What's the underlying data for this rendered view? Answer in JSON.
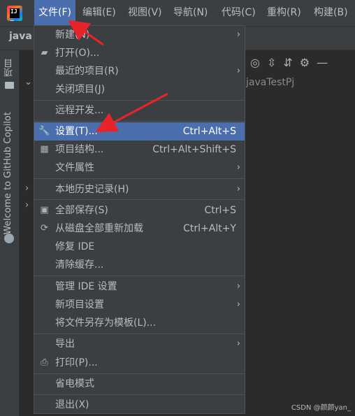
{
  "menubar": {
    "items": [
      "文件(F)",
      "编辑(E)",
      "视图(V)",
      "导航(N)",
      "代码(C)",
      "重构(R)",
      "构建(B)"
    ]
  },
  "tab": {
    "label": "java"
  },
  "side_panel": {
    "project_label": "项目",
    "copilot_label": "Welcome to GitHub Copilot"
  },
  "tree": {
    "project_name": "javaTestPj"
  },
  "file_menu": {
    "new": "新建(N)",
    "open": "打开(O)...",
    "recent": "最近的项目(R)",
    "close": "关闭项目(J)",
    "remote": "远程开发...",
    "settings": "设置(T)...",
    "settings_shortcut": "Ctrl+Alt+S",
    "structure": "项目结构...",
    "structure_shortcut": "Ctrl+Alt+Shift+S",
    "file_props": "文件属性",
    "local_history": "本地历史记录(H)",
    "save_all": "全部保存(S)",
    "save_all_shortcut": "Ctrl+S",
    "reload": "从磁盘全部重新加载",
    "reload_shortcut": "Ctrl+Alt+Y",
    "repair": "修复 IDE",
    "invalidate": "清除缓存...",
    "manage_ide": "管理 IDE 设置",
    "new_project_settings": "新项目设置",
    "save_template": "将文件另存为模板(L)...",
    "export": "导出",
    "print": "打印(P)...",
    "power_save": "省电模式",
    "exit": "退出(X)"
  },
  "watermark": "CSDN @颜颜yan_",
  "colors": {
    "highlight": "#4b6eaf",
    "arrow": "#e8232a",
    "menu_bg": "#3c3f41"
  }
}
